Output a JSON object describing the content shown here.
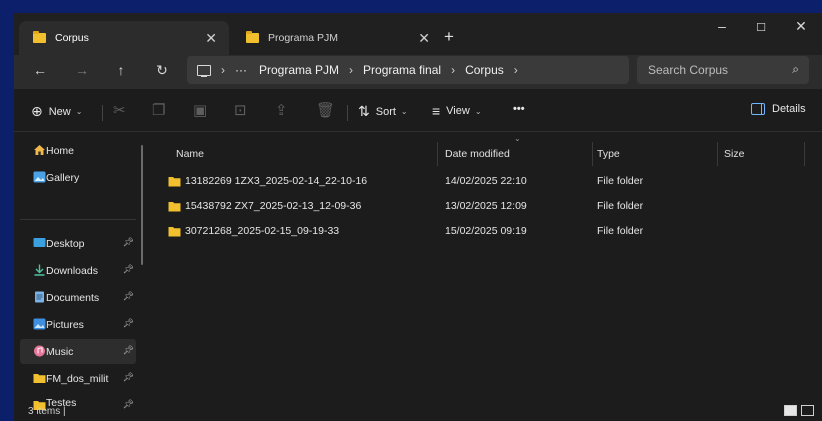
{
  "tabs": [
    {
      "label": "Corpus",
      "active": true
    },
    {
      "label": "Programa PJM",
      "active": false
    }
  ],
  "window_controls": {
    "minimize": "–",
    "maximize": "☐",
    "close": "✕"
  },
  "address": {
    "ellipsis": "···",
    "crumbs": [
      "Programa PJM",
      "Programa final",
      "Corpus"
    ]
  },
  "search": {
    "placeholder": "Search Corpus"
  },
  "commandbar": {
    "new_label": "New",
    "sort_label": "Sort",
    "view_label": "View",
    "more_label": "•••",
    "details_label": "Details"
  },
  "sidebar": {
    "items": [
      {
        "label": "Home",
        "icon": "home-icon",
        "pinned": false
      },
      {
        "label": "Gallery",
        "icon": "gallery-icon",
        "pinned": false
      },
      {
        "label": "Desktop",
        "icon": "desktop-icon",
        "pinned": true
      },
      {
        "label": "Downloads",
        "icon": "download-icon",
        "pinned": true
      },
      {
        "label": "Documents",
        "icon": "document-icon",
        "pinned": true
      },
      {
        "label": "Pictures",
        "icon": "pictures-icon",
        "pinned": true
      },
      {
        "label": "Music",
        "icon": "music-icon",
        "pinned": true,
        "selected": true
      },
      {
        "label": "FM_dos_milit",
        "icon": "folder-icon",
        "pinned": true
      },
      {
        "label": "Testes",
        "icon": "folder-icon",
        "pinned": true
      }
    ]
  },
  "columns": {
    "name": "Name",
    "date": "Date modified",
    "type": "Type",
    "size": "Size"
  },
  "files": [
    {
      "name": "13182269 1ZX3_2025-02-14_22-10-16",
      "date": "14/02/2025 22:10",
      "type": "File folder",
      "size": ""
    },
    {
      "name": "15438792 ZX7_2025-02-13_12-09-36",
      "date": "13/02/2025 12:09",
      "type": "File folder",
      "size": ""
    },
    {
      "name": "30721268_2025-02-15_09-19-33",
      "date": "15/02/2025 09:19",
      "type": "File folder",
      "size": ""
    }
  ],
  "status": {
    "text": "3 items  |"
  },
  "colors": {
    "desktop_bg": "#0b1f6b",
    "window_bg": "#1c1c1c",
    "folder": "#f2c02f",
    "accent": "#6fb6ff"
  }
}
